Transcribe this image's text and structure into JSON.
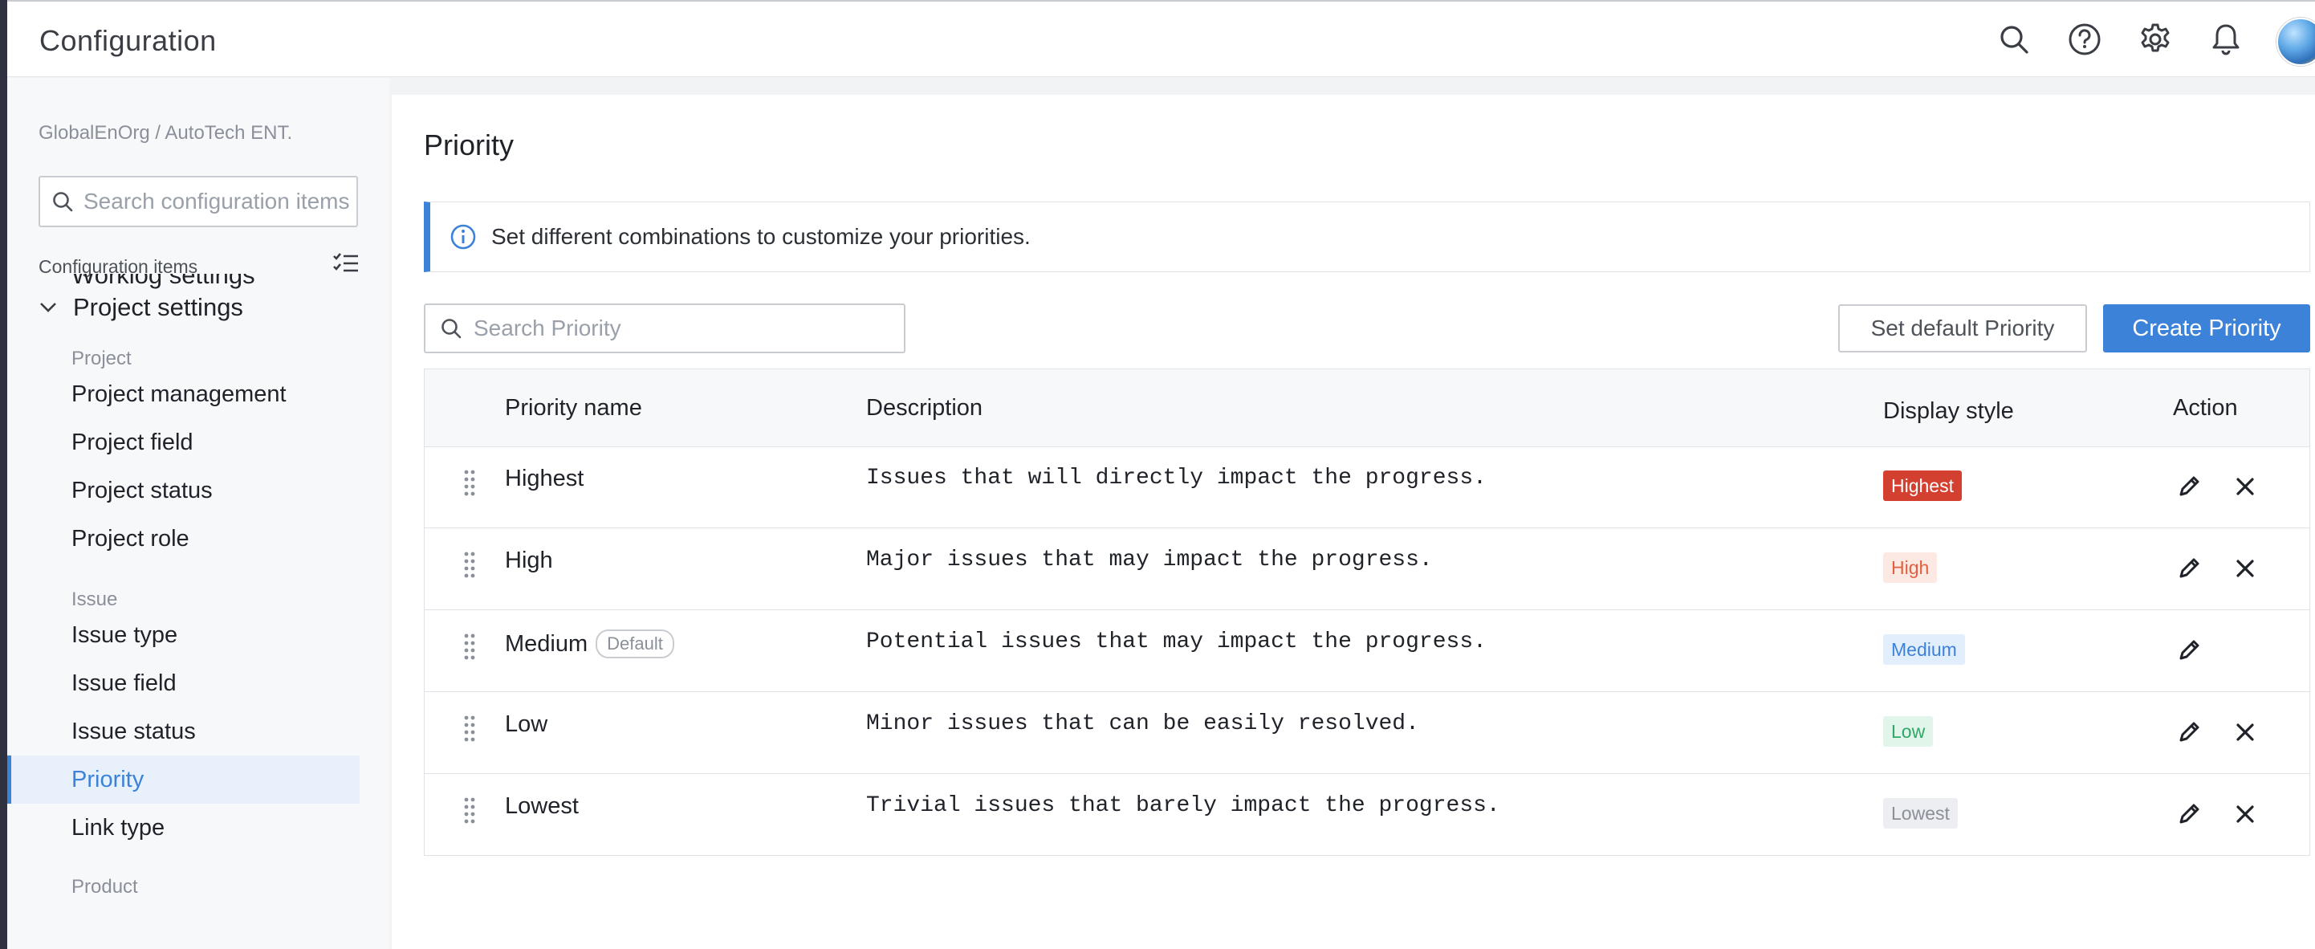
{
  "topbar": {
    "title": "Configuration",
    "icons": [
      "search-icon",
      "help-icon",
      "gear-icon",
      "bell-icon"
    ]
  },
  "sidebar": {
    "breadcrumb": "GlobalEnOrg / AutoTech ENT.",
    "search_placeholder": "Search configuration items",
    "config_items_label": "Configuration items",
    "worklog_label": "Worklog settings",
    "section_label": "Project settings",
    "groups": {
      "project": "Project",
      "issue": "Issue",
      "product": "Product"
    },
    "project_items": [
      "Project management",
      "Project field",
      "Project status",
      "Project role"
    ],
    "issue_items": [
      "Issue type",
      "Issue field",
      "Issue status",
      "Priority",
      "Link type"
    ],
    "active_item": "Priority"
  },
  "main": {
    "title": "Priority",
    "info": "Set different combinations to customize your priorities.",
    "search_placeholder": "Search Priority",
    "set_default_label": "Set default Priority",
    "create_label": "Create Priority",
    "columns": {
      "name": "Priority name",
      "description": "Description",
      "display": "Display style",
      "action": "Action"
    },
    "default_tag": "Default",
    "rows": [
      {
        "name": "Highest",
        "description": "Issues that will directly impact the progress.",
        "badge": "Highest",
        "badge_bg": "#d4402f",
        "badge_fg": "#ffffff",
        "deletable": true,
        "is_default": false
      },
      {
        "name": "High",
        "description": "Major issues that may impact the progress.",
        "badge": "High",
        "badge_bg": "#fde9e3",
        "badge_fg": "#e2603f",
        "deletable": true,
        "is_default": false
      },
      {
        "name": "Medium",
        "description": "Potential issues that may impact the progress.",
        "badge": "Medium",
        "badge_bg": "#e3eefc",
        "badge_fg": "#3c82d9",
        "deletable": false,
        "is_default": true
      },
      {
        "name": "Low",
        "description": "Minor issues that can be easily resolved.",
        "badge": "Low",
        "badge_bg": "#e2f5ea",
        "badge_fg": "#2fa866",
        "deletable": true,
        "is_default": false
      },
      {
        "name": "Lowest",
        "description": "Trivial issues that barely impact the progress.",
        "badge": "Lowest",
        "badge_bg": "#eceef1",
        "badge_fg": "#8a8f99",
        "deletable": true,
        "is_default": false
      }
    ]
  },
  "colors": {
    "accent": "#3c82d9",
    "sidebar_bg": "#f7f8fa",
    "active_bg": "#e8f0fb"
  }
}
